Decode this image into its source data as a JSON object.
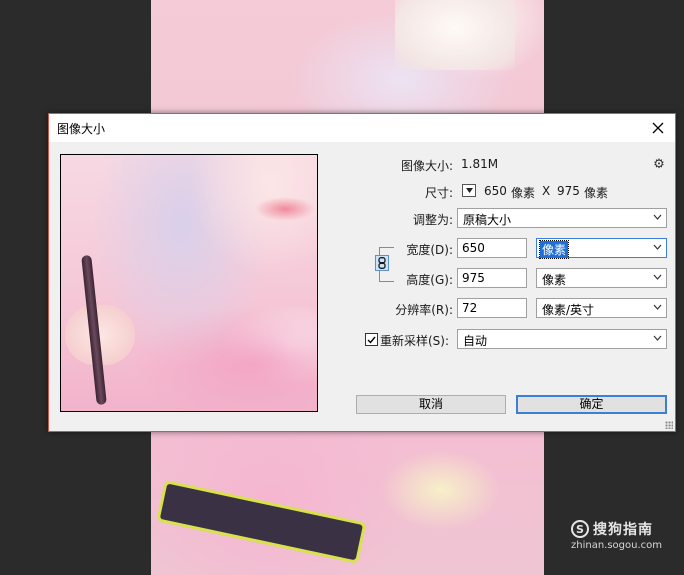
{
  "dialog": {
    "title": "图像大小",
    "image_size_label": "图像大小:",
    "image_size_value": "1.81M",
    "dimensions_label": "尺寸:",
    "dimensions_width": "650",
    "dimensions_unit_1": "像素",
    "dimensions_sep": "X",
    "dimensions_height": "975",
    "dimensions_unit_2": "像素",
    "fit_to_label": "调整为:",
    "fit_to_value": "原稿大小",
    "width_label": "宽度(D):",
    "width_value": "650",
    "width_unit": "像素",
    "height_label": "高度(G):",
    "height_value": "975",
    "height_unit": "像素",
    "resolution_label": "分辨率(R):",
    "resolution_value": "72",
    "resolution_unit": "像素/英寸",
    "resample_label": "重新采样(S):",
    "resample_checked": true,
    "resample_value": "自动",
    "cancel_label": "取消",
    "ok_label": "确定"
  },
  "watermark": {
    "brand": "搜狗指南",
    "url": "zhinan.sogou.com"
  },
  "colors": {
    "accent": "#3c7fd8",
    "selection": "#1e6fd9",
    "dialog_border": "#d0564a"
  }
}
